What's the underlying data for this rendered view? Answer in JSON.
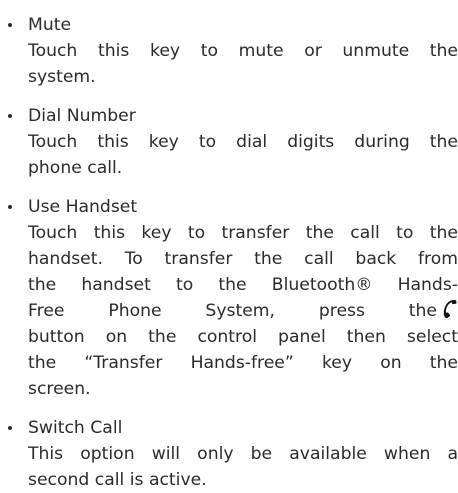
{
  "items": [
    {
      "term": "Mute",
      "desc_lines": [
        "Touch this key to mute or unmute the",
        "system."
      ]
    },
    {
      "term": "Dial Number",
      "desc_lines": [
        "Touch this key to dial digits during the",
        "phone call."
      ]
    },
    {
      "term": "Use Handset",
      "desc_lines": [
        "Touch this key to transfer the call to the",
        "handset. To transfer the call back from",
        "the handset to the Bluetooth® Hands-",
        "Free Phone System, press the",
        "button on the control panel then select",
        "the “Transfer Hands-free” key on the",
        "screen."
      ]
    },
    {
      "term": "Switch Call",
      "desc_lines": [
        "This option will only be available when a",
        "second call is active."
      ]
    }
  ],
  "icons": {
    "phone": "phone-handset-icon"
  }
}
